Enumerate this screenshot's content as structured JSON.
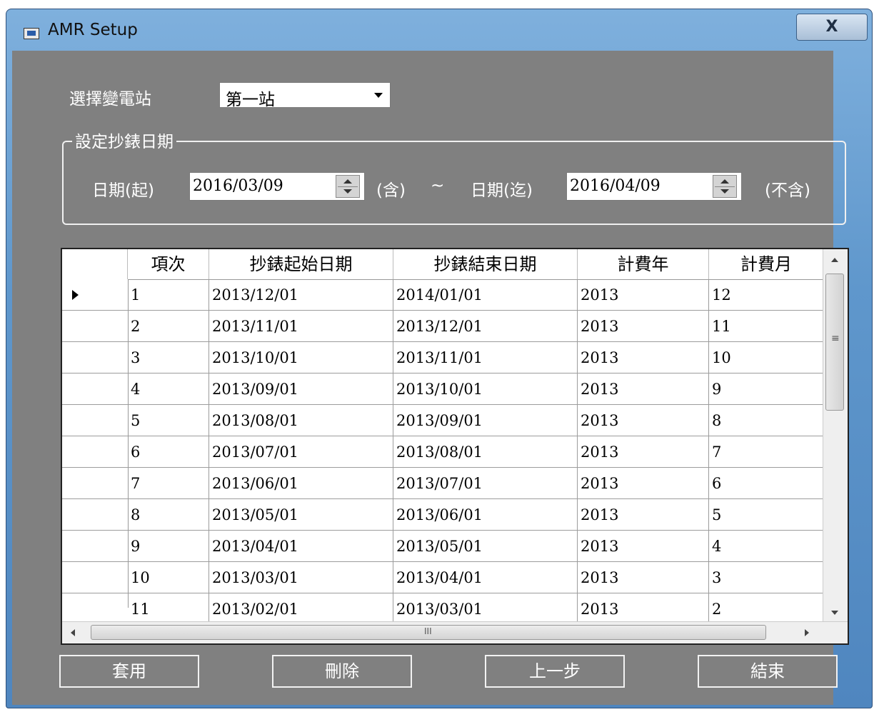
{
  "window": {
    "title": "AMR Setup",
    "close_label": "X"
  },
  "station": {
    "label": "選擇變電站",
    "selected": "第一站"
  },
  "date_group": {
    "title": "設定抄錶日期",
    "start_label": "日期(起)",
    "start_value": "2016/03/09",
    "start_note": "(含)",
    "tilde": "~",
    "end_label": "日期(迄)",
    "end_value": "2016/04/09",
    "end_note": "(不含)"
  },
  "table": {
    "columns": [
      "項次",
      "抄錶起始日期",
      "抄錶結束日期",
      "計費年",
      "計費月"
    ],
    "rows": [
      [
        "1",
        "2013/12/01",
        "2014/01/01",
        "2013",
        "12"
      ],
      [
        "2",
        "2013/11/01",
        "2013/12/01",
        "2013",
        "11"
      ],
      [
        "3",
        "2013/10/01",
        "2013/11/01",
        "2013",
        "10"
      ],
      [
        "4",
        "2013/09/01",
        "2013/10/01",
        "2013",
        "9"
      ],
      [
        "5",
        "2013/08/01",
        "2013/09/01",
        "2013",
        "8"
      ],
      [
        "6",
        "2013/07/01",
        "2013/08/01",
        "2013",
        "7"
      ],
      [
        "7",
        "2013/06/01",
        "2013/07/01",
        "2013",
        "6"
      ],
      [
        "8",
        "2013/05/01",
        "2013/06/01",
        "2013",
        "5"
      ],
      [
        "9",
        "2013/04/01",
        "2013/05/01",
        "2013",
        "4"
      ],
      [
        "10",
        "2013/03/01",
        "2013/04/01",
        "2013",
        "3"
      ],
      [
        "11",
        "2013/02/01",
        "2013/03/01",
        "2013",
        "2"
      ]
    ]
  },
  "buttons": {
    "apply": "套用",
    "delete": "刪除",
    "back": "上一步",
    "exit": "結束"
  }
}
